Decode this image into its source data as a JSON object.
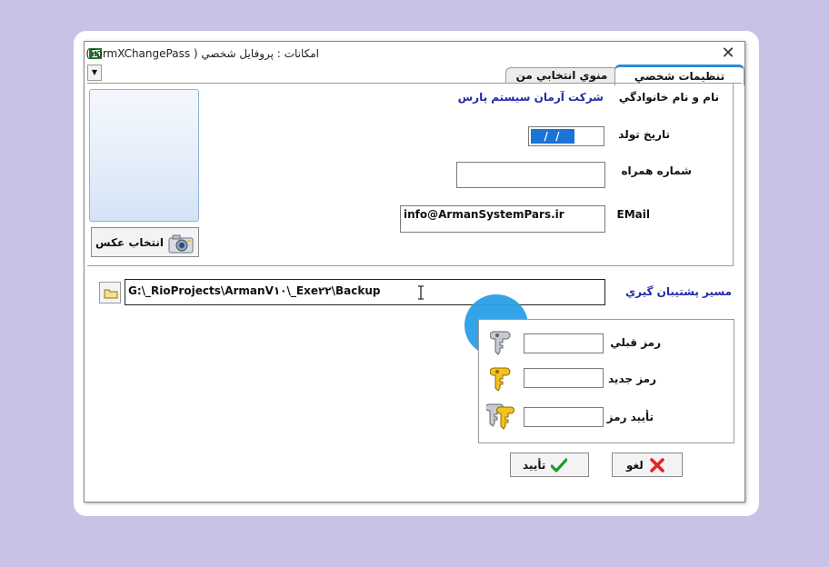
{
  "window": {
    "title": "امكانات : پروفايل شخصي ( FormXChangePass)",
    "close_symbol": "✕"
  },
  "menu": {
    "dropdown_symbol": "▼"
  },
  "tabs": [
    {
      "label": "تنظيمات شخصي",
      "active": true
    },
    {
      "label": "منوي انتخابي من",
      "active": false
    }
  ],
  "profile": {
    "fullname_label": "نام و نام خانوادگي",
    "fullname_value": "شركت آرمان سيستم پارس",
    "birthdate_label": "تاريخ تولد",
    "birthdate_value": "/ /",
    "mobile_label": "شماره همراه",
    "mobile_value": "",
    "email_label": "EMail",
    "email_value": "info@ArmanSystemPars.ir",
    "choose_photo_label": "انتخاب عكس"
  },
  "backup": {
    "label": "مسير پشتيبان گيري",
    "path_value": "G:\\_RioProjects\\ArmanV۱۰\\_Exe۲۲\\Backup"
  },
  "password": {
    "old_label": "رمز قبلي",
    "new_label": "رمز جديد",
    "confirm_label": "تأييد رمز"
  },
  "actions": {
    "ok_label": "تأييد",
    "cancel_label": "لغو"
  },
  "colors": {
    "accent_blue": "#1f2aa8",
    "selection_blue": "#1a73d6",
    "cursor_highlight": "#2a9ee6",
    "tab_accent": "#2e8bd4"
  }
}
